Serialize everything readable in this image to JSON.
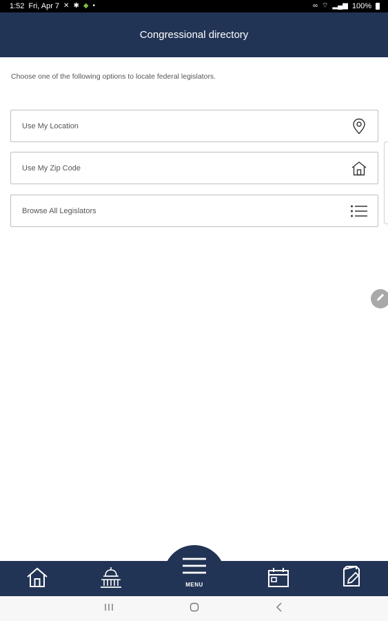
{
  "status_bar": {
    "time": "1:52",
    "date": "Fri, Apr 7",
    "battery": "100%"
  },
  "header": {
    "title": "Congressional directory"
  },
  "intro_text": "Choose one of the following options to locate federal legislators.",
  "options": [
    {
      "label": "Use My Location",
      "icon": "location-pin-icon"
    },
    {
      "label": "Use My Zip Code",
      "icon": "house-icon"
    },
    {
      "label": "Browse All Legislators",
      "icon": "list-icon"
    }
  ],
  "bottom_nav": {
    "menu_label": "MENU",
    "items": [
      "home-icon",
      "capitol-icon",
      "menu-icon",
      "calendar-icon",
      "document-edit-icon"
    ]
  },
  "colors": {
    "navy": "#223455",
    "border": "#bfbfbf"
  }
}
